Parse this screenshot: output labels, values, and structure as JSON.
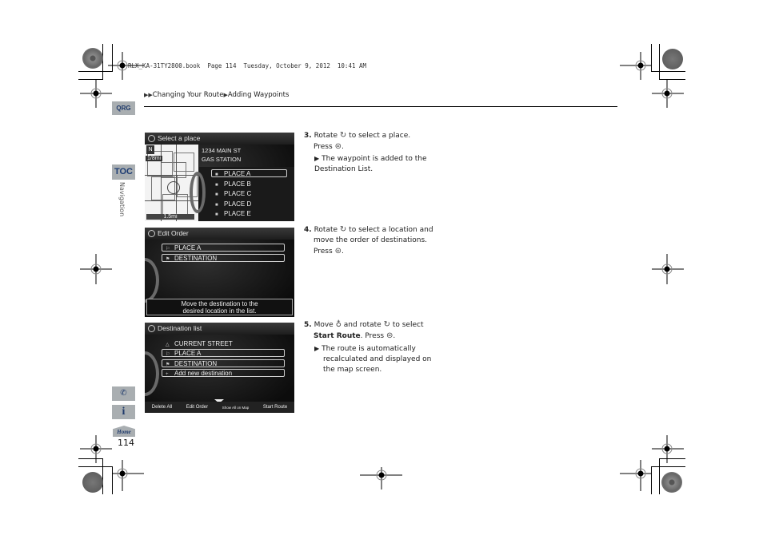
{
  "print_header": "RLX_KA-31TY2800.book  Page 114  Tuesday, October 9, 2012  10:41 AM",
  "breadcrumb": {
    "items": [
      "Changing Your Route",
      "Adding Waypoints"
    ]
  },
  "side_tabs": {
    "qrg": "QRG",
    "toc": "TOC",
    "section_label": "Navigation",
    "voice_icon": "voice-command-icon",
    "info_icon": "info-icon",
    "home": "Home"
  },
  "page_number": "114",
  "screens": {
    "select_place": {
      "title": "Select a place",
      "address_line1": "1234 MAIN ST",
      "address_line2": "GAS STATION",
      "map_scale_top": "1/8mi",
      "map_scale_bottom": "1.5mi",
      "items": [
        "PLACE A",
        "PLACE B",
        "PLACE C",
        "PLACE D",
        "PLACE E"
      ]
    },
    "edit_order": {
      "title": "Edit Order",
      "items": [
        "PLACE A",
        "DESTINATION"
      ],
      "message_line1": "Move the destination to the",
      "message_line2": "desired location in the list."
    },
    "destination_list": {
      "title": "Destination list",
      "current": "CURRENT STREET",
      "items": [
        "PLACE A",
        "DESTINATION"
      ],
      "add_new": "Add new destination",
      "softkeys": [
        "Delete All",
        "Edit Order",
        "Show All on Map",
        "Start Route"
      ]
    }
  },
  "steps": [
    {
      "number": "3.",
      "text_a": "Rotate",
      "text_b": "to select a place.",
      "text_c": "Press",
      "text_d": ".",
      "note": "The waypoint is added to the Destination List."
    },
    {
      "number": "4.",
      "text_a": "Rotate",
      "text_b": "to select a location and",
      "text_line2": "move the order of destinations.",
      "text_c": "Press",
      "text_d": "."
    },
    {
      "number": "5.",
      "text_a": "Move",
      "text_b": "and rotate",
      "text_c": "to select",
      "bold": "Start Route",
      "text_d": ". Press",
      "text_e": ".",
      "note_line1": "The route is automatically",
      "note_line2": "recalculated and displayed on",
      "note_line3": "the map screen."
    }
  ]
}
